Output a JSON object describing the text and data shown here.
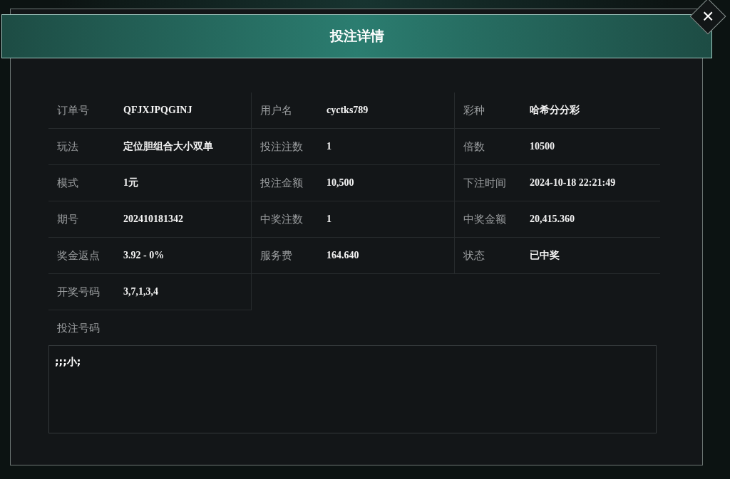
{
  "dialog": {
    "title": "投注详情",
    "close_label": "×"
  },
  "fields": [
    {
      "label": "订单号",
      "value": "QFJXJPQGINJ"
    },
    {
      "label": "用户名",
      "value": "cyctks789"
    },
    {
      "label": "彩种",
      "value": "哈希分分彩"
    },
    {
      "label": "玩法",
      "value": "定位胆组合大小双单"
    },
    {
      "label": "投注注数",
      "value": "1"
    },
    {
      "label": "倍数",
      "value": "10500"
    },
    {
      "label": "模式",
      "value": "1元"
    },
    {
      "label": "投注金额",
      "value": "10,500"
    },
    {
      "label": "下注时间",
      "value": "2024-10-18 22:21:49"
    },
    {
      "label": "期号",
      "value": "202410181342"
    },
    {
      "label": "中奖注数",
      "value": "1"
    },
    {
      "label": "中奖金额",
      "value": "20,415.360"
    },
    {
      "label": "奖金返点",
      "value": "3.92 - 0%"
    },
    {
      "label": "服务费",
      "value": "164.640"
    },
    {
      "label": "状态",
      "value": "已中奖"
    },
    {
      "label": "开奖号码",
      "value": "3,7,1,3,4"
    }
  ],
  "bet_numbers": {
    "label": "投注号码",
    "value": ";;;小;"
  }
}
